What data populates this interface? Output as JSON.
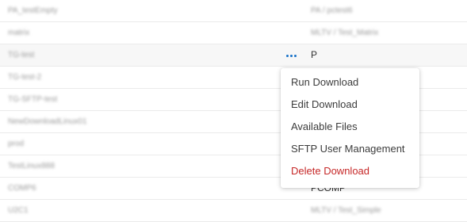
{
  "rows": [
    {
      "name": "PA_testEmpty",
      "dest": "PA / pctest6"
    },
    {
      "name": "matrix",
      "dest": "MLTV / Test_Matrix"
    },
    {
      "name": "TG-test",
      "dest": "P"
    },
    {
      "name": "TG-test-2",
      "dest": ""
    },
    {
      "name": "TG-SFTP-test",
      "dest": ""
    },
    {
      "name": "NewDownloadLinux01",
      "dest": ""
    },
    {
      "name": "prod",
      "dest": ""
    },
    {
      "name": "TestLinux888",
      "dest": ""
    },
    {
      "name": "COMP6",
      "dest": "PCOMP"
    },
    {
      "name": "U2C1",
      "dest": "MLTV / Test_Simple"
    }
  ],
  "more_icon": "ellipsis-horizontal-icon",
  "accent_color": "#1a73c8",
  "danger_color": "#c62828",
  "context_menu": {
    "items": [
      {
        "label": "Run Download"
      },
      {
        "label": "Edit Download"
      },
      {
        "label": "Available Files"
      },
      {
        "label": "SFTP User Management"
      },
      {
        "label": "Delete Download"
      }
    ]
  }
}
